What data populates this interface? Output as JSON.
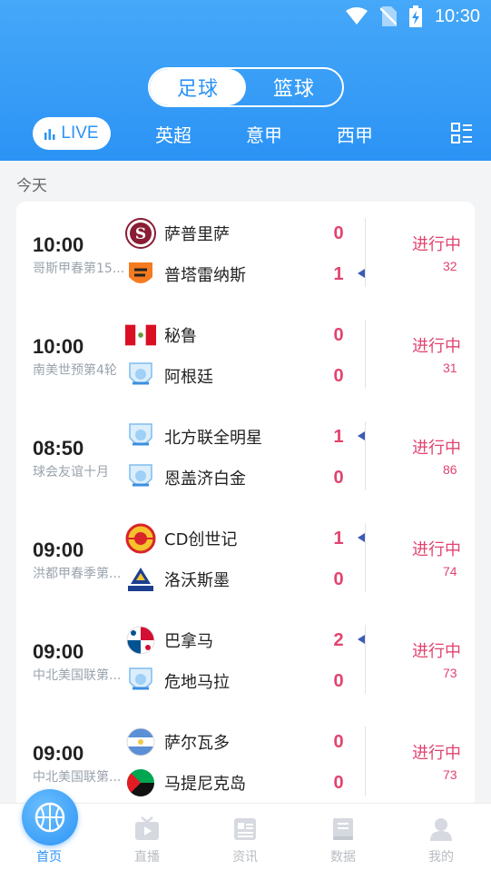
{
  "status_bar": {
    "time": "10:30"
  },
  "sport_toggle": {
    "football": "足球",
    "basketball": "篮球"
  },
  "league_tabs": {
    "live": "LIVE",
    "premier_league": "英超",
    "serie_a": "意甲",
    "la_liga": "西甲"
  },
  "date_label": "今天",
  "matches": [
    {
      "time": "10:00",
      "league": "哥斯甲春第15...",
      "home": "萨普里萨",
      "away": "普塔雷纳斯",
      "home_score": "0",
      "away_score": "1",
      "attacking": "away",
      "status": "进行中",
      "minute": "32"
    },
    {
      "time": "10:00",
      "league": "南美世预第4轮",
      "home": "秘鲁",
      "away": "阿根廷",
      "home_score": "0",
      "away_score": "0",
      "attacking": "none",
      "status": "进行中",
      "minute": "31"
    },
    {
      "time": "08:50",
      "league": "球会友谊十月",
      "home": "北方联全明星",
      "away": "恩盖济白金",
      "home_score": "1",
      "away_score": "0",
      "attacking": "home",
      "status": "进行中",
      "minute": "86"
    },
    {
      "time": "09:00",
      "league": "洪都甲春季第...",
      "home": "CD创世记",
      "away": "洛沃斯墨",
      "home_score": "1",
      "away_score": "0",
      "attacking": "home",
      "status": "进行中",
      "minute": "74"
    },
    {
      "time": "09:00",
      "league": "中北美国联第...",
      "home": "巴拿马",
      "away": "危地马拉",
      "home_score": "2",
      "away_score": "0",
      "attacking": "home",
      "status": "进行中",
      "minute": "73"
    },
    {
      "time": "09:00",
      "league": "中北美国联第...",
      "home": "萨尔瓦多",
      "away": "马提尼克岛",
      "home_score": "0",
      "away_score": "0",
      "attacking": "none",
      "status": "进行中",
      "minute": "73"
    }
  ],
  "bottom_nav": {
    "home": "首页",
    "live": "直播",
    "news": "资讯",
    "data": "数据",
    "mine": "我的"
  },
  "colors": {
    "primary": "#2b93f5",
    "live_red": "#e2436f",
    "attack_arrow": "#3b5bb8"
  }
}
